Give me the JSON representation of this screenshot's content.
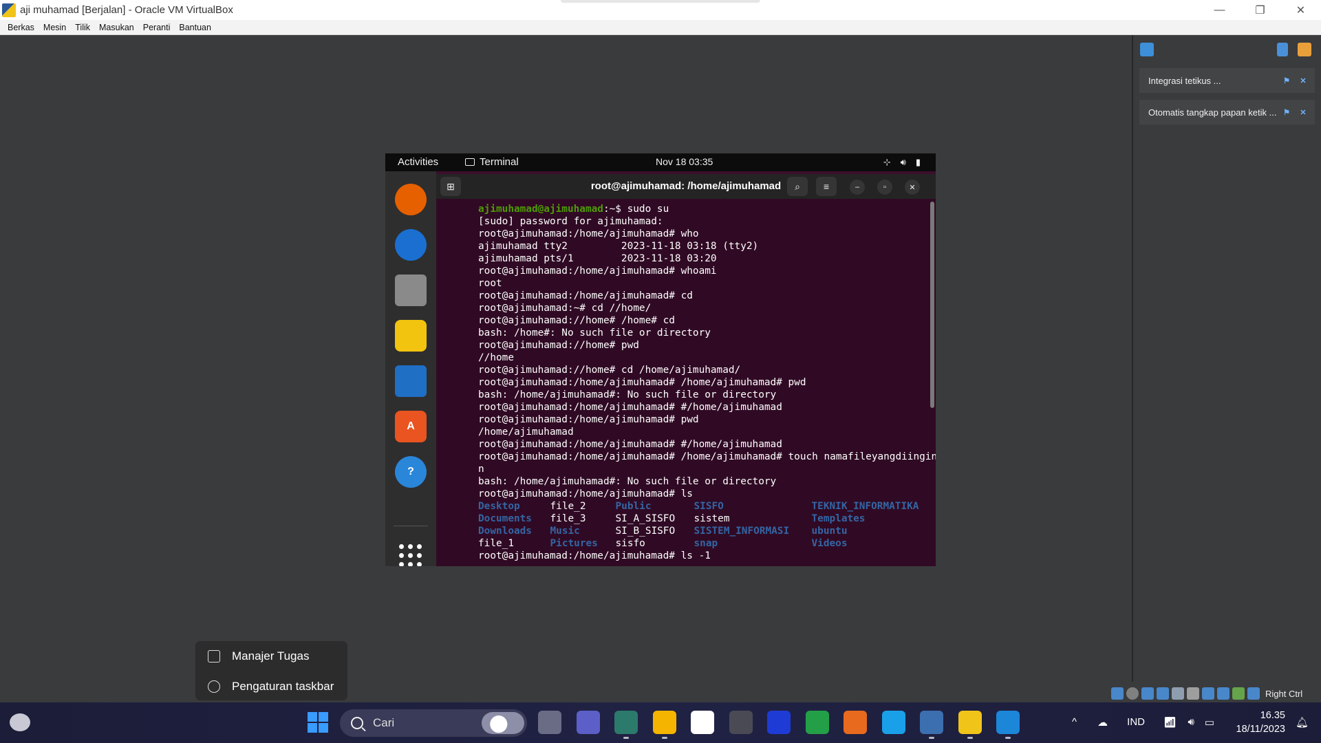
{
  "window": {
    "title": "aji muhamad  [Berjalan] - Oracle VM VirtualBox",
    "minimize_glyph": "—",
    "restore_glyph": "❐",
    "close_glyph": "✕"
  },
  "menubar": [
    "Berkas",
    "Mesin",
    "Tilik",
    "Masukan",
    "Peranti",
    "Bantuan"
  ],
  "side_panel": {
    "notifications": [
      {
        "text": "Integrasi tetikus ..."
      },
      {
        "text": "Otomatis tangkap papan ketik ..."
      }
    ]
  },
  "guest": {
    "topbar": {
      "activities": "Activities",
      "app_name": "Terminal",
      "clock": "Nov 18  03:35"
    },
    "dock": [
      {
        "name": "firefox-icon",
        "color": "#e66000"
      },
      {
        "name": "thunderbird-icon",
        "color": "#1a6fd1"
      },
      {
        "name": "files-icon",
        "color": "#8a8a8a"
      },
      {
        "name": "rhythmbox-icon",
        "color": "#f2c40f"
      },
      {
        "name": "writer-icon",
        "color": "#1f6fc4"
      },
      {
        "name": "software-icon",
        "color": "#e95420"
      },
      {
        "name": "help-icon",
        "color": "#2a86d9"
      }
    ],
    "terminal": {
      "title": "root@ajimuhamad: /home/ajimuhamad",
      "prompt_user": "ajimuhamad@ajimuhamad",
      "prompt_rest": ":~$ sudo su",
      "lines": [
        "[sudo] password for ajimuhamad:",
        "root@ajimuhamad:/home/ajimuhamad# who",
        "ajimuhamad tty2         2023-11-18 03:18 (tty2)",
        "ajimuhamad pts/1        2023-11-18 03:20",
        "root@ajimuhamad:/home/ajimuhamad# whoami",
        "root",
        "root@ajimuhamad:/home/ajimuhamad# cd",
        "root@ajimuhamad:~# cd //home/",
        "root@ajimuhamad://home# /home# cd",
        "bash: /home#: No such file or directory",
        "root@ajimuhamad://home# pwd",
        "//home",
        "root@ajimuhamad://home# cd /home/ajimuhamad/",
        "root@ajimuhamad:/home/ajimuhamad# /home/ajimuhamad# pwd",
        "bash: /home/ajimuhamad#: No such file or directory",
        "root@ajimuhamad:/home/ajimuhamad# #/home/ajimuhamad",
        "root@ajimuhamad:/home/ajimuhamad# pwd",
        "/home/ajimuhamad",
        "root@ajimuhamad:/home/ajimuhamad# #/home/ajimuhamad",
        "root@ajimuhamad:/home/ajimuhamad# /home/ajimuhamad# touch namafileyangdiinginka",
        "n",
        "bash: /home/ajimuhamad#: No such file or directory",
        "root@ajimuhamad:/home/ajimuhamad# ls"
      ],
      "ls_rows": [
        [
          {
            "t": "Desktop",
            "d": true
          },
          {
            "t": "file_2",
            "d": false
          },
          {
            "t": "Public",
            "d": true
          },
          {
            "t": "SISFO",
            "d": true
          },
          {
            "t": "TEKNIK_INFORMATIKA",
            "d": true
          }
        ],
        [
          {
            "t": "Documents",
            "d": true
          },
          {
            "t": "file_3",
            "d": false
          },
          {
            "t": "SI_A_SISFO",
            "d": false
          },
          {
            "t": "sistem",
            "d": false
          },
          {
            "t": "Templates",
            "d": true
          }
        ],
        [
          {
            "t": "Downloads",
            "d": true
          },
          {
            "t": "Music",
            "d": true
          },
          {
            "t": "SI_B_SISFO",
            "d": false
          },
          {
            "t": "SISTEM_INFORMASI",
            "d": true
          },
          {
            "t": "ubuntu",
            "d": true
          }
        ],
        [
          {
            "t": "file_1",
            "d": false
          },
          {
            "t": "Pictures",
            "d": true
          },
          {
            "t": "sisfo",
            "d": false
          },
          {
            "t": "snap",
            "d": true
          },
          {
            "t": "Videos",
            "d": true
          }
        ]
      ],
      "last_line": "root@ajimuhamad:/home/ajimuhamad# ls -1"
    }
  },
  "context_menu": {
    "items": [
      {
        "label": "Manajer Tugas"
      },
      {
        "label": "Pengaturan taskbar"
      }
    ]
  },
  "vb_status": {
    "host_key": "Right Ctrl"
  },
  "taskbar": {
    "search_placeholder": "Cari",
    "apps": [
      {
        "name": "task-view-icon",
        "color": "#6a6c86",
        "glyph": ""
      },
      {
        "name": "teams-icon",
        "color": "#5b5fc7",
        "glyph": ""
      },
      {
        "name": "app-green-icon",
        "color": "#2c7a6b",
        "glyph": ""
      },
      {
        "name": "file-explorer-icon",
        "color": "#f4b400",
        "glyph": ""
      },
      {
        "name": "ms-store-icon",
        "color": "#ffffff",
        "glyph": ""
      },
      {
        "name": "unity-icon",
        "color": "#4a4a55",
        "glyph": ""
      },
      {
        "name": "app-blue-icon",
        "color": "#1f3bd6",
        "glyph": ""
      },
      {
        "name": "xbox-icon",
        "color": "#23a047",
        "glyph": ""
      },
      {
        "name": "firefox-taskbar-icon",
        "color": "#e86a1e",
        "glyph": ""
      },
      {
        "name": "edge-icon",
        "color": "#1aa0e8",
        "glyph": ""
      },
      {
        "name": "virtualbox-icon",
        "color": "#3c6fb0",
        "glyph": ""
      },
      {
        "name": "virtualbox-vm-icon",
        "color": "#f0c419",
        "glyph": ""
      },
      {
        "name": "app-paint-icon",
        "color": "#1c86d9",
        "glyph": ""
      }
    ],
    "tray": {
      "chevron": "^",
      "language": "IND",
      "time": "16.35",
      "date": "18/11/2023"
    }
  }
}
